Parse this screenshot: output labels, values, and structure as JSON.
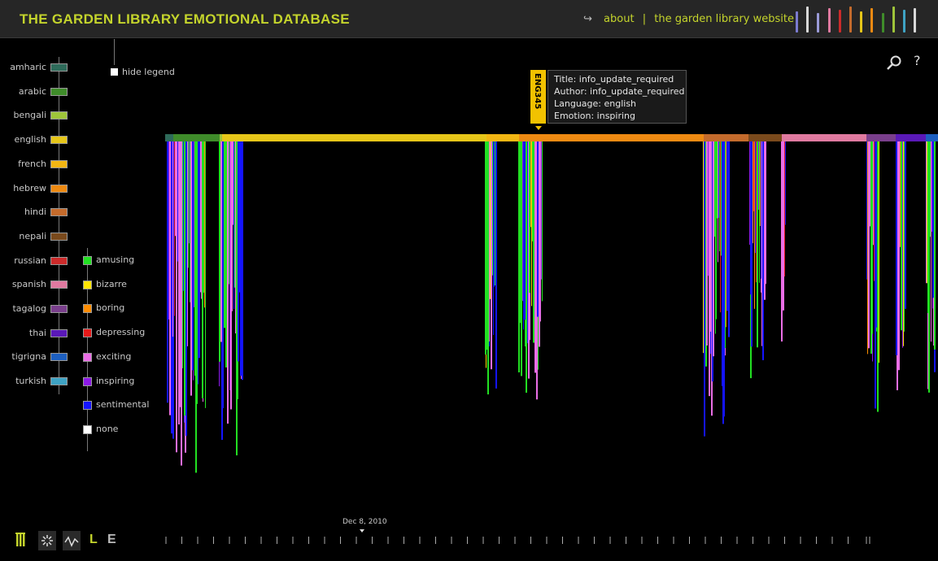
{
  "header": {
    "title": "THE GARDEN LIBRARY EMOTIONAL DATABASE",
    "nav": {
      "arrow": "↪",
      "about": "about",
      "separator": "|",
      "website": "the garden library website"
    }
  },
  "legend": {
    "hide_legend": "hide legend",
    "languages": [
      {
        "name": "amharic",
        "color": "#2e6b5a"
      },
      {
        "name": "arabic",
        "color": "#3f8c2a"
      },
      {
        "name": "bengali",
        "color": "#9ec43a"
      },
      {
        "name": "english",
        "color": "#e6c619"
      },
      {
        "name": "french",
        "color": "#f2b613"
      },
      {
        "name": "hebrew",
        "color": "#ee8a12"
      },
      {
        "name": "hindi",
        "color": "#c46b2c"
      },
      {
        "name": "nepali",
        "color": "#7a4a1c"
      },
      {
        "name": "russian",
        "color": "#cc2b2b"
      },
      {
        "name": "spanish",
        "color": "#e07aa0"
      },
      {
        "name": "tagalog",
        "color": "#7a3f8c"
      },
      {
        "name": "thai",
        "color": "#5a19b8"
      },
      {
        "name": "tigrigna",
        "color": "#1d5fc0"
      },
      {
        "name": "turkish",
        "color": "#3fa3c4"
      }
    ],
    "emotions": [
      {
        "name": "amusing",
        "color": "#22e022"
      },
      {
        "name": "bizarre",
        "color": "#ffe400"
      },
      {
        "name": "boring",
        "color": "#ff8c00"
      },
      {
        "name": "depressing",
        "color": "#e61a1a"
      },
      {
        "name": "exciting",
        "color": "#ea6ee6"
      },
      {
        "name": "inspiring",
        "color": "#8c19e6"
      },
      {
        "name": "sentimental",
        "color": "#1414ff"
      },
      {
        "name": "none",
        "color": "#ffffff"
      }
    ]
  },
  "tooltip": {
    "code": "ENG345",
    "title": "Title: info_update_required",
    "author": "Author: info_update_required",
    "language": "Language: english",
    "emotion": "Emotion: inspiring"
  },
  "timeline": {
    "date_label": "Dec 8, 2010"
  },
  "toolbar": {
    "letter_l": "L",
    "letter_e": "E",
    "l_color": "#c4d42c",
    "e_color": "#bbbbbb"
  },
  "icons": {
    "search": "search-icon",
    "help": "?"
  },
  "colors": {
    "accent": "#c4d42c",
    "background": "#000000",
    "header": "#262626"
  }
}
